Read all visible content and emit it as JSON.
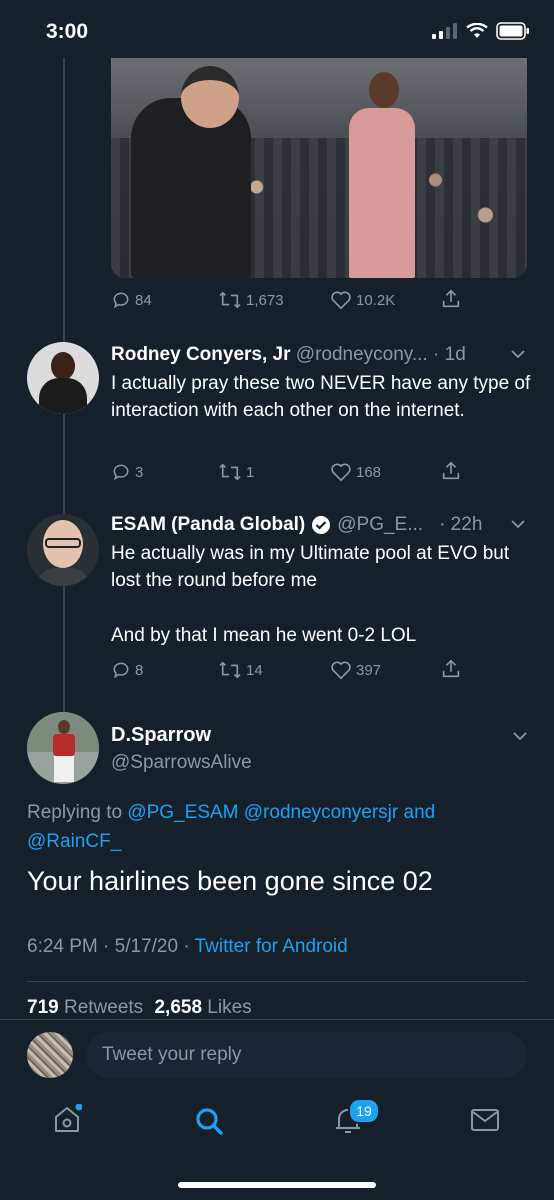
{
  "status": {
    "time": "3:00"
  },
  "stats_row_1": {
    "replies": "84",
    "retweets": "1,673",
    "likes": "10.2K"
  },
  "tweets": [
    {
      "name": "Rodney Conyers, Jr",
      "handle": "@rodneycony...",
      "time": "· 1d",
      "text": "I actually pray these two NEVER have any type of interaction with each other on the internet.",
      "replies": "3",
      "retweets": "1",
      "likes": "168"
    },
    {
      "name": "ESAM (Panda Global)",
      "handle": "@PG_E...",
      "time": "· 22h",
      "text_line1": "He actually was in my Ultimate pool at EVO but lost the round before me",
      "text_line2": "And by that I mean he went 0-2 LOL",
      "replies": "8",
      "retweets": "14",
      "likes": "397"
    }
  ],
  "main": {
    "name": "D.Sparrow",
    "handle": "@SparrowsAlive",
    "replying_to": "Replying to",
    "mentions": "@PG_ESAM @rodneyconyersjr and",
    "mentions2": "@RainCF_",
    "text": "Your hairlines been gone since 02",
    "time": "6:24 PM · 5/17/20 ·",
    "source": "Twitter for Android",
    "retweet_count": "719",
    "retweet_label": "Retweets",
    "like_count": "2,658",
    "like_label": "Likes"
  },
  "reply_placeholder": "Tweet your reply",
  "tabbar": {
    "notifications_badge": "19"
  },
  "colors": {
    "background": "#15202b",
    "accent": "#1da1f2",
    "muted": "#8899a6"
  }
}
